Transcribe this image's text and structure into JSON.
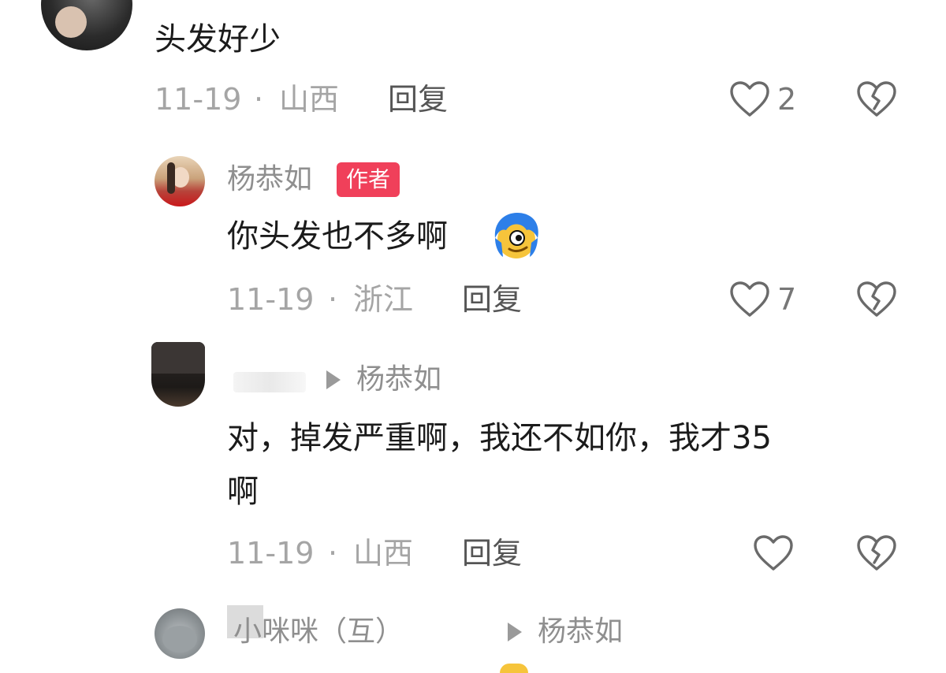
{
  "comments": [
    {
      "text": "头发好少",
      "date": "11-19",
      "sep": "·",
      "location": "山西",
      "reply_label": "回复",
      "likes": "2"
    },
    {
      "author": "杨恭如",
      "author_badge": "作者",
      "text": "你头发也不多啊",
      "date": "11-19",
      "sep": "·",
      "location": "浙江",
      "reply_label": "回复",
      "likes": "7"
    },
    {
      "reply_to": "杨恭如",
      "text_line1": "对，掉发严重啊，我还不如你，我才35",
      "text_line2": "啊",
      "date": "11-19",
      "sep": "·",
      "location": "山西",
      "reply_label": "回复"
    },
    {
      "author": "小咪咪（互）",
      "reply_to": "杨恭如"
    }
  ],
  "icons": {
    "like": "heart-icon",
    "dislike": "broken-heart-icon",
    "emoji": "blue-hair-smirk-emoji",
    "reply_arrow": "play-triangle-icon"
  },
  "colors": {
    "badge": "#f0405a",
    "meta": "#a5a5a5"
  }
}
